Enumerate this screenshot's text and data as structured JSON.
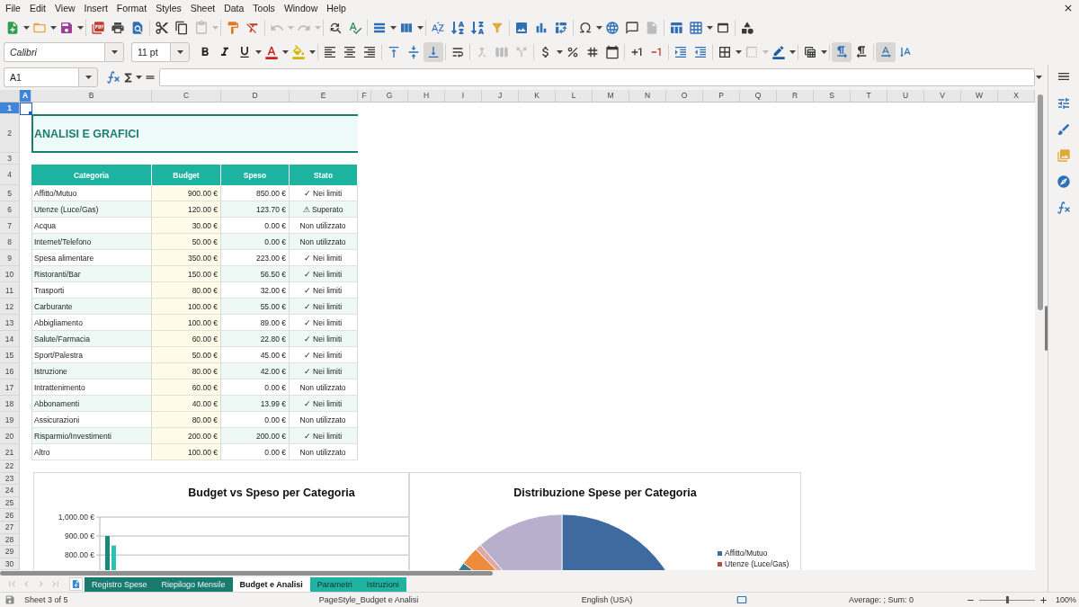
{
  "menu": [
    "File",
    "Edit",
    "View",
    "Insert",
    "Format",
    "Styles",
    "Sheet",
    "Data",
    "Tools",
    "Window",
    "Help"
  ],
  "standard_toolbar": [
    {
      "disabled": false
    },
    {
      "disabled": false
    },
    {
      "disabled": false
    },
    {
      "disabled": false
    },
    {
      "disabled": false
    },
    {
      "disabled": false
    },
    {
      "disabled": false
    },
    {
      "disabled": false
    },
    {
      "disabled": true
    },
    {
      "disabled": false
    },
    {
      "disabled": false
    },
    {
      "disabled": true
    },
    {
      "disabled": true
    },
    {
      "disabled": false
    },
    {
      "disabled": false
    },
    {
      "disabled": false
    },
    {
      "disabled": false
    },
    {
      "disabled": false
    },
    {
      "disabled": false
    },
    {
      "disabled": false
    },
    {
      "disabled": false
    },
    {
      "disabled": false
    },
    {
      "disabled": false
    },
    {
      "disabled": false
    },
    {
      "disabled": false
    },
    {
      "disabled": false
    },
    {
      "disabled": false
    },
    {
      "disabled": true
    },
    {
      "disabled": false
    },
    {
      "disabled": false
    },
    {
      "disabled": false
    },
    {
      "disabled": false
    }
  ],
  "formatting_toolbar": {
    "font_name": "Calibri",
    "font_size": "11 pt",
    "buttons": [
      {
        "disabled": false,
        "pressed": false
      },
      {
        "disabled": false,
        "pressed": false
      },
      {
        "disabled": false,
        "pressed": false
      },
      {
        "disabled": false,
        "pressed": false
      },
      {
        "disabled": false,
        "pressed": false
      },
      {
        "disabled": false,
        "pressed": false
      },
      {
        "disabled": false,
        "pressed": false
      },
      {
        "disabled": false,
        "pressed": false
      },
      {
        "disabled": false,
        "pressed": false
      },
      {
        "disabled": false,
        "pressed": false
      },
      {
        "disabled": false,
        "pressed": true
      },
      {
        "disabled": false,
        "pressed": false
      },
      {
        "disabled": true,
        "pressed": false
      },
      {
        "disabled": true,
        "pressed": false
      },
      {
        "disabled": true,
        "pressed": false
      },
      {
        "disabled": false,
        "pressed": false
      },
      {
        "disabled": false,
        "pressed": false
      },
      {
        "disabled": false,
        "pressed": false
      },
      {
        "disabled": false,
        "pressed": false
      },
      {
        "disabled": false,
        "pressed": false
      },
      {
        "disabled": false,
        "pressed": false
      },
      {
        "disabled": false,
        "pressed": false
      },
      {
        "disabled": false,
        "pressed": false
      },
      {
        "disabled": false,
        "pressed": false
      },
      {
        "disabled": true,
        "pressed": false
      },
      {
        "disabled": false,
        "pressed": false
      },
      {
        "disabled": false,
        "pressed": false
      },
      {
        "disabled": false,
        "pressed": true
      },
      {
        "disabled": false,
        "pressed": false
      },
      {
        "disabled": false,
        "pressed": true
      },
      {
        "disabled": false,
        "pressed": false
      }
    ]
  },
  "formula_bar": {
    "name_box": "A1"
  },
  "column_headers": [
    {
      "label": "A",
      "selected": true
    },
    {
      "label": "B",
      "selected": false
    },
    {
      "label": "C",
      "selected": false
    },
    {
      "label": "D",
      "selected": false
    },
    {
      "label": "E",
      "selected": false
    },
    {
      "label": "F",
      "selected": false
    },
    {
      "label": "G",
      "selected": false
    },
    {
      "label": "H",
      "selected": false
    },
    {
      "label": "I",
      "selected": false
    },
    {
      "label": "J",
      "selected": false
    },
    {
      "label": "K",
      "selected": false
    },
    {
      "label": "L",
      "selected": false
    },
    {
      "label": "M",
      "selected": false
    },
    {
      "label": "N",
      "selected": false
    },
    {
      "label": "O",
      "selected": false
    },
    {
      "label": "P",
      "selected": false
    },
    {
      "label": "Q",
      "selected": false
    },
    {
      "label": "R",
      "selected": false
    },
    {
      "label": "S",
      "selected": false
    },
    {
      "label": "T",
      "selected": false
    },
    {
      "label": "U",
      "selected": false
    },
    {
      "label": "V",
      "selected": false
    },
    {
      "label": "W",
      "selected": false
    },
    {
      "label": "X",
      "selected": false
    }
  ],
  "row_headers": [
    {
      "label": "1",
      "selected": true
    },
    {
      "label": "2",
      "selected": false
    },
    {
      "label": "3",
      "selected": false
    },
    {
      "label": "4",
      "selected": false
    },
    {
      "label": "5",
      "selected": false
    },
    {
      "label": "6",
      "selected": false
    },
    {
      "label": "7",
      "selected": false
    },
    {
      "label": "8",
      "selected": false
    },
    {
      "label": "9",
      "selected": false
    },
    {
      "label": "10",
      "selected": false
    },
    {
      "label": "11",
      "selected": false
    },
    {
      "label": "12",
      "selected": false
    },
    {
      "label": "13",
      "selected": false
    },
    {
      "label": "14",
      "selected": false
    },
    {
      "label": "15",
      "selected": false
    },
    {
      "label": "16",
      "selected": false
    },
    {
      "label": "17",
      "selected": false
    },
    {
      "label": "18",
      "selected": false
    },
    {
      "label": "19",
      "selected": false
    },
    {
      "label": "20",
      "selected": false
    },
    {
      "label": "21",
      "selected": false
    },
    {
      "label": "22",
      "selected": false
    },
    {
      "label": "23",
      "selected": false
    },
    {
      "label": "24",
      "selected": false
    },
    {
      "label": "25",
      "selected": false
    },
    {
      "label": "26",
      "selected": false
    },
    {
      "label": "27",
      "selected": false
    },
    {
      "label": "28",
      "selected": false
    },
    {
      "label": "29",
      "selected": false
    },
    {
      "label": "30",
      "selected": false
    }
  ],
  "sheet": {
    "title": "ANALISI E GRAFICI",
    "table": {
      "columns": [
        "Categoria",
        "Budget",
        "Speso",
        "Stato"
      ],
      "rows": [
        {
          "categoria": "Affitto/Mutuo",
          "budget": "900.00 €",
          "speso": "850.00 €",
          "stato": "✓ Nei limiti"
        },
        {
          "categoria": "Utenze (Luce/Gas)",
          "budget": "120.00 €",
          "speso": "123.70 €",
          "stato": "⚠ Superato"
        },
        {
          "categoria": "Acqua",
          "budget": "30.00 €",
          "speso": "0.00 €",
          "stato": "Non utilizzato"
        },
        {
          "categoria": "Internet/Telefono",
          "budget": "50.00 €",
          "speso": "0.00 €",
          "stato": "Non utilizzato"
        },
        {
          "categoria": "Spesa alimentare",
          "budget": "350.00 €",
          "speso": "223.00 €",
          "stato": "✓ Nei limiti"
        },
        {
          "categoria": "Ristoranti/Bar",
          "budget": "150.00 €",
          "speso": "56.50 €",
          "stato": "✓ Nei limiti"
        },
        {
          "categoria": "Trasporti",
          "budget": "80.00 €",
          "speso": "32.00 €",
          "stato": "✓ Nei limiti"
        },
        {
          "categoria": "Carburante",
          "budget": "100.00 €",
          "speso": "55.00 €",
          "stato": "✓ Nei limiti"
        },
        {
          "categoria": "Abbigliamento",
          "budget": "100.00 €",
          "speso": "89.00 €",
          "stato": "✓ Nei limiti"
        },
        {
          "categoria": "Salute/Farmacia",
          "budget": "60.00 €",
          "speso": "22.80 €",
          "stato": "✓ Nei limiti"
        },
        {
          "categoria": "Sport/Palestra",
          "budget": "50.00 €",
          "speso": "45.00 €",
          "stato": "✓ Nei limiti"
        },
        {
          "categoria": "Istruzione",
          "budget": "80.00 €",
          "speso": "42.00 €",
          "stato": "✓ Nei limiti"
        },
        {
          "categoria": "Intrattenimento",
          "budget": "60.00 €",
          "speso": "0.00 €",
          "stato": "Non utilizzato"
        },
        {
          "categoria": "Abbonamenti",
          "budget": "40.00 €",
          "speso": "13.99 €",
          "stato": "✓ Nei limiti"
        },
        {
          "categoria": "Assicurazioni",
          "budget": "80.00 €",
          "speso": "0.00 €",
          "stato": "Non utilizzato"
        },
        {
          "categoria": "Risparmio/Investimenti",
          "budget": "200.00 €",
          "speso": "200.00 €",
          "stato": "✓ Nei limiti"
        },
        {
          "categoria": "Altro",
          "budget": "100.00 €",
          "speso": "0.00 €",
          "stato": "Non utilizzato"
        }
      ]
    }
  },
  "bar_chart": {
    "chart_data": {
      "type": "bar",
      "title": "Budget vs Speso per Categoria",
      "ylim": [
        720,
        1000
      ],
      "yticks": [
        {
          "value": 1000,
          "label": "1,000.00 €"
        },
        {
          "value": 900,
          "label": "900.00 €"
        },
        {
          "value": 800,
          "label": "800.00 €"
        }
      ],
      "stacked": false,
      "series": [
        {
          "color": "#188a7a",
          "values": [
            900
          ]
        },
        {
          "color": "#2ec1b0",
          "values": [
            850
          ]
        }
      ]
    }
  },
  "pie_chart": {
    "title": "Distribuzione Spese per Categoria",
    "legend": [
      {
        "label": "Affitto/Mutuo",
        "color": "#3e6a9f"
      },
      {
        "label": "Utenze (Luce/Gas)",
        "color": "#b84a47"
      }
    ]
  },
  "sheet_navigation": [
    {
      "disabled": true
    },
    {
      "disabled": true
    },
    {
      "disabled": true
    },
    {
      "disabled": true
    }
  ],
  "sheet_tabs": [
    {
      "label": "Registro Spese",
      "selected": false,
      "color": "#1a7a6e"
    },
    {
      "label": "Riepilogo Mensile",
      "selected": false,
      "color": "#1a7a6e"
    },
    {
      "label": "Budget e Analisi",
      "selected": true
    },
    {
      "label": "Parametri",
      "selected": false,
      "color": "#1fb4a2"
    },
    {
      "label": "Istruzioni",
      "selected": false,
      "color": "#1fb4a2"
    }
  ],
  "status_bar": {
    "sheet": "Sheet 3 of 5",
    "page_style": "PageStyle_Budget e Analisi",
    "language": "English (USA)",
    "selection_summary": "Average: ; Sum: 0",
    "zoom": {
      "level": 0.5,
      "reading": "100%"
    }
  }
}
